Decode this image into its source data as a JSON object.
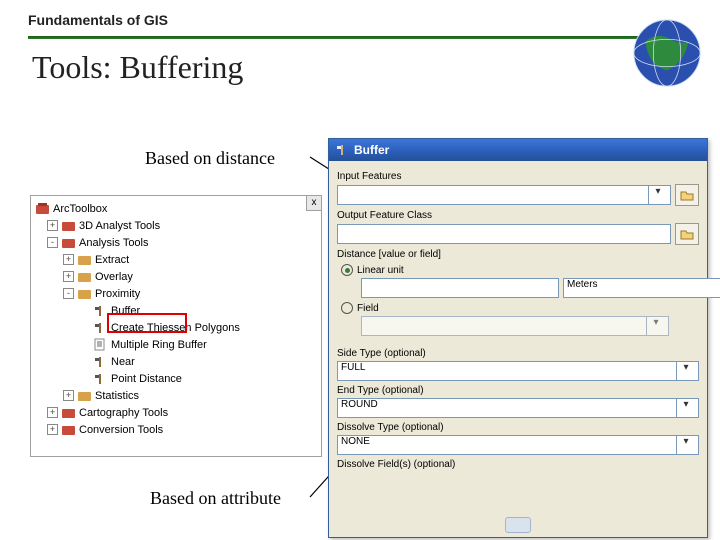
{
  "header": {
    "course": "Fundamentals of GIS",
    "title": "Tools: Buffering"
  },
  "annotations": {
    "distance": "Based on distance",
    "attribute": "Based on attribute"
  },
  "toolbox": {
    "close": "x",
    "root": "ArcToolbox",
    "items": [
      {
        "exp": "+",
        "label": "3D Analyst Tools",
        "kind": "tb"
      },
      {
        "exp": "-",
        "label": "Analysis Tools",
        "kind": "tb"
      }
    ],
    "analysis": [
      {
        "exp": "+",
        "label": "Extract",
        "kind": "folder"
      },
      {
        "exp": "+",
        "label": "Overlay",
        "kind": "folder"
      },
      {
        "exp": "-",
        "label": "Proximity",
        "kind": "folder"
      }
    ],
    "proximity": [
      {
        "label": "Buffer"
      },
      {
        "label": "Create Thiessen Polygons"
      },
      {
        "label": "Multiple Ring Buffer"
      },
      {
        "label": "Near"
      },
      {
        "label": "Point Distance"
      }
    ],
    "after": [
      {
        "exp": "+",
        "label": "Statistics",
        "kind": "folder"
      },
      {
        "exp": "+",
        "label": "Cartography Tools",
        "kind": "tb",
        "level": 1
      },
      {
        "exp": "+",
        "label": "Conversion Tools",
        "kind": "tb",
        "level": 1
      }
    ]
  },
  "dialog": {
    "title": "Buffer",
    "sections": {
      "input": "Input Features",
      "output": "Output Feature Class",
      "dist": "Distance [value or field]",
      "linear": "Linear unit",
      "units": "Meters",
      "field": "Field",
      "side": "Side Type (optional)",
      "side_val": "FULL",
      "end": "End Type (optional)",
      "end_val": "ROUND",
      "dissolve": "Dissolve Type (optional)",
      "dissolve_val": "NONE",
      "dfields": "Dissolve Field(s) (optional)"
    }
  }
}
